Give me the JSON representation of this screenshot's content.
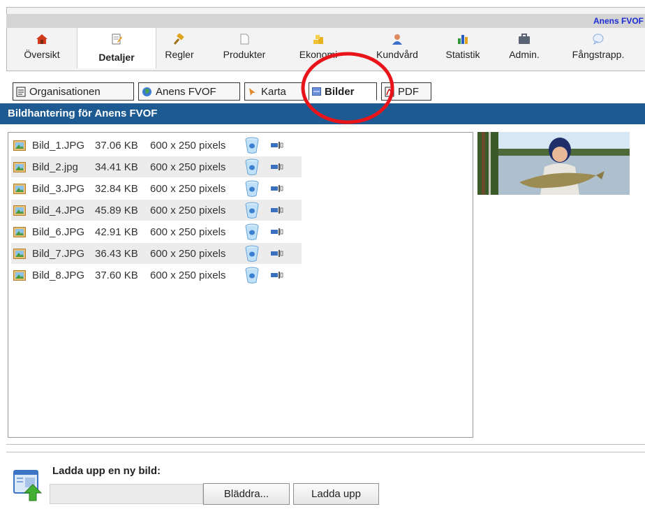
{
  "header": {
    "org_name": "Anens FVOF"
  },
  "nav": {
    "items": [
      {
        "label": "Översikt",
        "icon": "house-icon"
      },
      {
        "label": "Detaljer",
        "icon": "edit-icon",
        "active": true
      },
      {
        "label": "Regler",
        "icon": "gavel-icon"
      },
      {
        "label": "Produkter",
        "icon": "document-icon"
      },
      {
        "label": "Ekonomi",
        "icon": "coins-icon"
      },
      {
        "label": "Kundvård",
        "icon": "user-icon"
      },
      {
        "label": "Statistik",
        "icon": "bar-chart-icon"
      },
      {
        "label": "Admin.",
        "icon": "briefcase-icon"
      },
      {
        "label": "Fångstrapp.",
        "icon": "speech-bubble-icon"
      }
    ]
  },
  "subtabs": [
    {
      "label": "Organisationen",
      "icon": "document-icon"
    },
    {
      "label": "Anens FVOF",
      "icon": "globe-icon"
    },
    {
      "label": "Karta",
      "icon": "map-pin-icon"
    },
    {
      "label": "Bilder",
      "icon": "image-icon",
      "active": true
    },
    {
      "label": "PDF",
      "icon": "pdf-icon"
    }
  ],
  "section": {
    "title": "Bildhantering för Anens FVOF"
  },
  "files": [
    {
      "name": "Bild_1.JPG",
      "size": "37.06 KB",
      "dimensions": "600 x 250 pixels"
    },
    {
      "name": "Bild_2.jpg",
      "size": "34.41 KB",
      "dimensions": "600 x 250 pixels"
    },
    {
      "name": "Bild_3.JPG",
      "size": "32.84 KB",
      "dimensions": "600 x 250 pixels"
    },
    {
      "name": "Bild_4.JPG",
      "size": "45.89 KB",
      "dimensions": "600 x 250 pixels"
    },
    {
      "name": "Bild_6.JPG",
      "size": "42.91 KB",
      "dimensions": "600 x 250 pixels"
    },
    {
      "name": "Bild_7.JPG",
      "size": "36.43 KB",
      "dimensions": "600 x 250 pixels"
    },
    {
      "name": "Bild_8.JPG",
      "size": "37.60 KB",
      "dimensions": "600 x 250 pixels"
    }
  ],
  "upload": {
    "label": "Ladda upp en ny bild:",
    "file_value": "",
    "browse_label": "Bläddra...",
    "upload_label": "Ladda upp"
  },
  "colors": {
    "header_bar": "#1d5a91",
    "org_name": "#1a2bd6",
    "annotation": "#e8141a"
  }
}
